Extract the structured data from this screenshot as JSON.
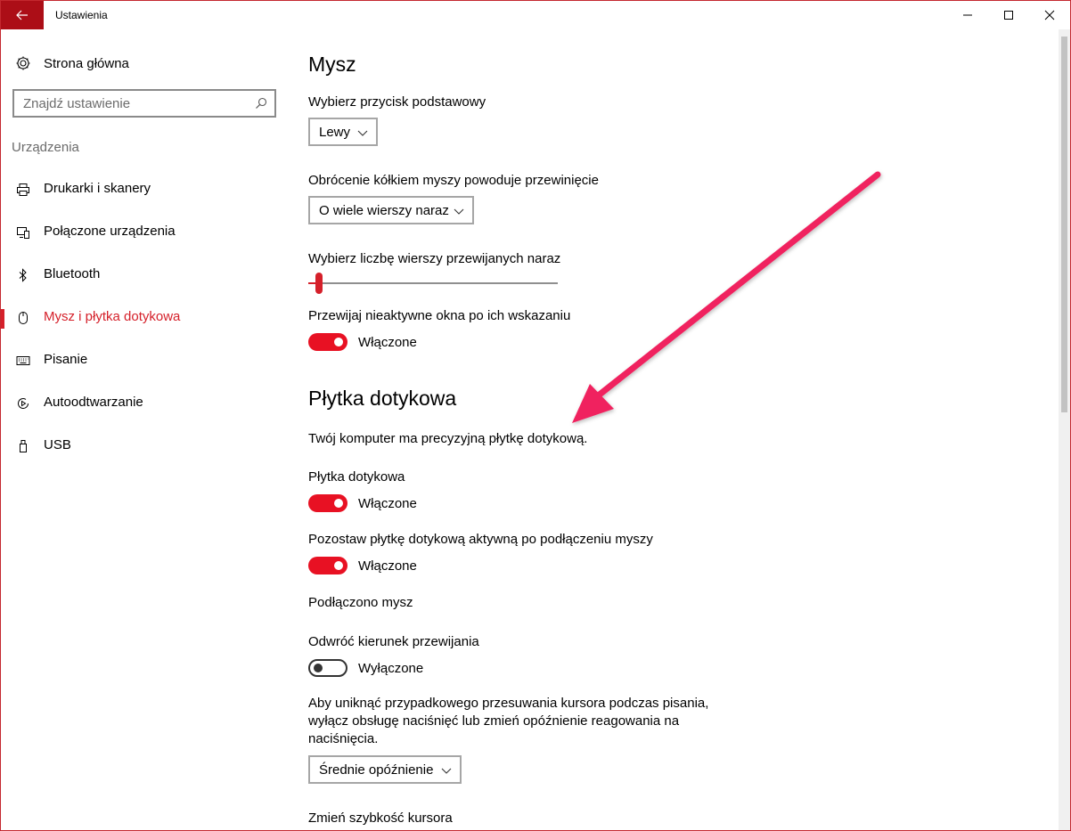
{
  "window": {
    "title": "Ustawienia",
    "accent_color": "#d5202a",
    "icons": {
      "back": "back-arrow-icon",
      "minimize": "minimize-icon",
      "maximize": "maximize-icon",
      "close": "close-icon"
    }
  },
  "sidebar": {
    "home_label": "Strona główna",
    "search_placeholder": "Znajdź ustawienie",
    "section_label": "Urządzenia",
    "items": [
      {
        "label": "Drukarki i skanery",
        "icon": "printer-icon",
        "active": false
      },
      {
        "label": "Połączone urządzenia",
        "icon": "connected-devices-icon",
        "active": false
      },
      {
        "label": "Bluetooth",
        "icon": "bluetooth-icon",
        "active": false
      },
      {
        "label": "Mysz i płytka dotykowa",
        "icon": "mouse-icon",
        "active": true
      },
      {
        "label": "Pisanie",
        "icon": "keyboard-icon",
        "active": false
      },
      {
        "label": "Autoodtwarzanie",
        "icon": "autoplay-icon",
        "active": false
      },
      {
        "label": "USB",
        "icon": "usb-icon",
        "active": false
      }
    ]
  },
  "mouse": {
    "heading": "Mysz",
    "primary_button_label": "Wybierz przycisk podstawowy",
    "primary_button_value": "Lewy",
    "scroll_label": "Obrócenie kółkiem myszy powoduje przewinięcie",
    "scroll_value": "O wiele wierszy naraz",
    "lines_label": "Wybierz liczbę wierszy przewijanych naraz",
    "lines_slider_fraction": 0.03,
    "inactive_scroll_label": "Przewijaj nieaktywne okna po ich wskazaniu",
    "inactive_scroll_state": "Włączone"
  },
  "touchpad": {
    "heading": "Płytka dotykowa",
    "precision_text": "Twój komputer ma precyzyjną płytkę dotykową.",
    "touchpad_label": "Płytka dotykowa",
    "touchpad_state": "Włączone",
    "keep_on_label": "Pozostaw płytkę dotykową aktywną po podłączeniu myszy",
    "keep_on_state": "Włączone",
    "mouse_connected_text": "Podłączono mysz",
    "reverse_label": "Odwróć kierunek przewijania",
    "reverse_state": "Wyłączone",
    "delay_description": "Aby uniknąć przypadkowego przesuwania kursora podczas pisania, wyłącz obsługę naciśnięć lub zmień opóźnienie reagowania na naciśnięcia.",
    "delay_value": "Średnie opóźnienie",
    "cursor_speed_label": "Zmień szybkość kursora"
  },
  "annotation": {
    "arrow_color": "#f0245e"
  }
}
